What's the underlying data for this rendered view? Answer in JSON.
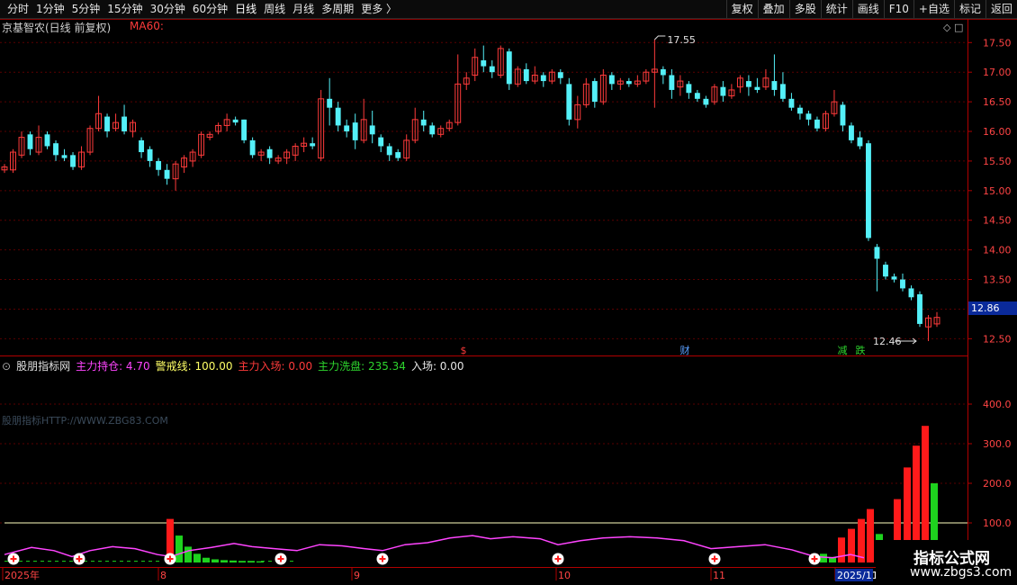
{
  "toolbar": {
    "periods": [
      "分时",
      "1分钟",
      "5分钟",
      "15分钟",
      "30分钟",
      "60分钟",
      "日线",
      "周线",
      "月线",
      "多周期",
      "更多 〉"
    ],
    "active_period": "日线",
    "right_buttons": [
      "复权",
      "叠加",
      "多股",
      "统计",
      "画线",
      "F10",
      "+自选",
      "返回"
    ],
    "right_label": "标记"
  },
  "main_chart": {
    "title": "京基智农(日线 前复权)",
    "ma_label": "MA60:",
    "y_ticks": [
      "17.50",
      "17.00",
      "16.50",
      "16.00",
      "15.50",
      "15.00",
      "14.50",
      "14.00",
      "13.50",
      "13.00",
      "12.50"
    ],
    "current_price": "12.86",
    "high_label": "17.55",
    "low_label": "12.46",
    "event_tags": [
      {
        "text": "$",
        "color": "#ff3b3b"
      },
      {
        "text": "财",
        "color": "#5aa0ff"
      },
      {
        "text": "减",
        "color": "#2ed52e"
      },
      {
        "text": "跌",
        "color": "#2ed52e"
      }
    ],
    "colors": {
      "up": "#ff3b3b",
      "down": "#54f0f8"
    }
  },
  "sub_chart": {
    "source": "股朋指标网",
    "items": [
      {
        "label": "主力持仓: 4.70",
        "color": "#ff44ff"
      },
      {
        "label": "警戒线: 100.00",
        "color": "#ffff66"
      },
      {
        "label": "主力入场: 0.00",
        "color": "#ff3b3b"
      },
      {
        "label": "主力洗盘: 235.34",
        "color": "#2ed52e"
      },
      {
        "label": "入场: 0.00",
        "color": "#e6e6e6"
      }
    ],
    "watermark": "股朋指标HTTP://WWW.ZBG83.COM",
    "y_ticks": [
      "400.0",
      "300.0",
      "200.0",
      "100.0"
    ]
  },
  "x_axis": {
    "labels": [
      "2025年",
      "8",
      "9",
      "10",
      "11",
      "2025/11"
    ]
  },
  "corner_logo": {
    "line1": "指标公式网",
    "line2": "www.zbgs3.com"
  }
}
